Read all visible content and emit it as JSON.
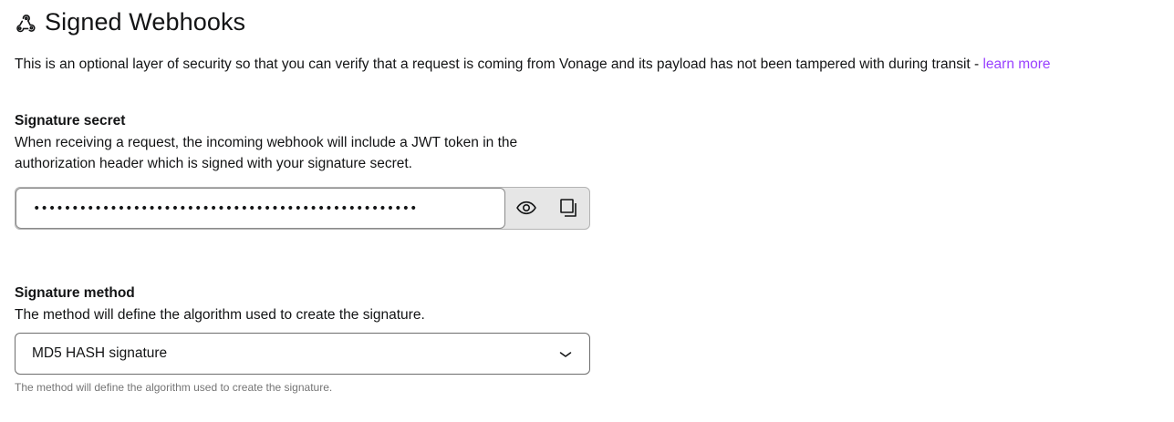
{
  "header": {
    "icon": "webhook-icon",
    "title": "Signed Webhooks"
  },
  "intro": {
    "text": "This is an optional layer of security so that you can verify that a request is coming from Vonage and its payload has not been tampered with during transit - ",
    "link_label": "learn more"
  },
  "signature_secret": {
    "label": "Signature secret",
    "help": "When receiving a request, the incoming webhook will include a JWT token in the authorization header which is signed with your signature secret.",
    "masked_value": "••••••••••••••••••••••••••••••••••••••••••••••••••",
    "show_icon": "eye-icon",
    "copy_icon": "copy-icon"
  },
  "signature_method": {
    "label": "Signature method",
    "help": "The method will define the algorithm used to create the signature.",
    "selected": "MD5 HASH signature",
    "dropdown_icon": "chevron-down-icon",
    "hint": "The method will define the algorithm used to create the signature."
  },
  "colors": {
    "link": "#9941ff",
    "text": "#131415",
    "hint": "#757575",
    "addon_bg": "#e6e6e6"
  }
}
